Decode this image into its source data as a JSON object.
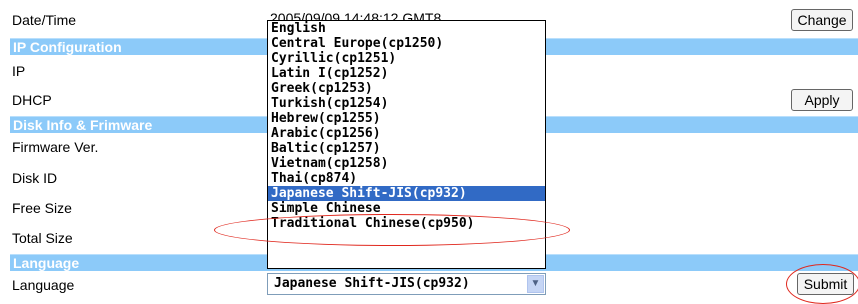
{
  "rows": {
    "datetime_label": "Date/Time",
    "datetime_value": "2005/09/09 14:48:12 GMT8",
    "ip_label": "IP",
    "dhcp_label": "DHCP",
    "firmware_label": "Firmware Ver.",
    "disk_id_label": "Disk ID",
    "free_size_label": "Free Size",
    "total_size_label": "Total Size",
    "language_label": "Language"
  },
  "sections": {
    "ip_configuration": "IP Configuration",
    "disk_info": "Disk Info & Frimware",
    "language": "Language"
  },
  "buttons": {
    "change": "Change",
    "apply": "Apply",
    "submit": "Submit"
  },
  "language_select": {
    "selected": "Japanese Shift-JIS(cp932)",
    "selected_index": 11,
    "options": [
      "English",
      "Central Europe(cp1250)",
      "Cyrillic(cp1251)",
      "Latin I(cp1252)",
      "Greek(cp1253)",
      "Turkish(cp1254)",
      "Hebrew(cp1255)",
      "Arabic(cp1256)",
      "Baltic(cp1257)",
      "Vietnam(cp1258)",
      "Thai(cp874)",
      "Japanese Shift-JIS(cp932)",
      "Simple Chinese",
      "Traditional Chinese(cp950)"
    ],
    "arrow_icon": "chevron-down-icon"
  },
  "colors": {
    "section_bar": "#8ccaf9",
    "highlight": "#316ac5",
    "annotation": "#e0281e"
  }
}
